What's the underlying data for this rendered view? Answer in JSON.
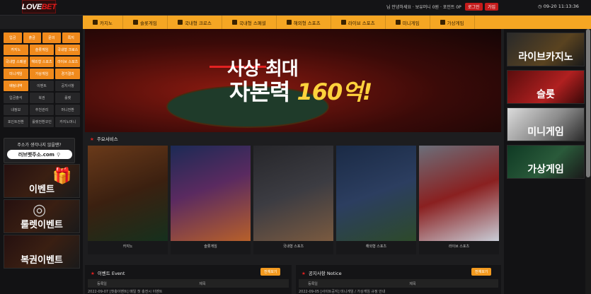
{
  "header": {
    "logo_main": "LOVE",
    "logo_accent": "BET",
    "welcome": "님 안녕하세요 · 보유머니 0원 · 포인트 0P",
    "login": "로그인",
    "join": "가입",
    "clock": "09-20 11:13:36"
  },
  "nav": [
    "카지노",
    "슬롯게임",
    "국내형 크로스",
    "국내형 스페셜",
    "해외형 스포츠",
    "라이브 스포츠",
    "미니게임",
    "가상게임"
  ],
  "left": {
    "rows": [
      [
        "입금",
        "출금",
        "문의",
        "쪽지"
      ],
      [
        "카지노",
        "슬롯게임",
        "국내형 크로스"
      ],
      [
        "국내형 스페셜",
        "해외형 스포츠",
        "라이브 스포츠"
      ],
      [
        "미니게임",
        "가상게임",
        "경기결과"
      ],
      [
        "배팅내역",
        "이벤트",
        "공지사항"
      ],
      [
        "입금출석",
        "북권",
        "룰렛"
      ],
      [
        "내정보",
        "추천관리",
        "머니전환"
      ],
      [
        "포인트전환",
        "룰렛전환코인",
        "카지노머니"
      ]
    ],
    "domain_title": "주소가 생각나지 않을땐?",
    "domain_value": "러브벳주소.com",
    "banners": [
      "이벤트",
      "룰렛이벤트",
      "복권이벤트"
    ]
  },
  "hero": {
    "line1_a": "사상 ",
    "line1_b": "최대",
    "line2_a": "자본력 ",
    "line2_b": "160억!"
  },
  "services": {
    "title": "주요서비스",
    "items": [
      "카지노",
      "슬롯게임",
      "국내형 스포츠",
      "해외형 스포츠",
      "라이브 스포츠"
    ]
  },
  "boards": {
    "event_title": "이벤트 Event",
    "notice_title": "공지사항 Notice",
    "more": "전체보기",
    "col_date": "등록일",
    "col_title": "제목",
    "event_row": "2022-09-07  [첫충이벤트] 매일 첫 충전시 이벤트",
    "notice_row": "2022-09-05  [사이트공지] 미니게임 / 가상게임 규정 안내"
  },
  "right_banners": [
    "라이브카지노",
    "슬롯",
    "미니게임",
    "가상게임"
  ],
  "colors": {
    "accent": "#f5a623",
    "brand_red": "#e11d1d"
  }
}
